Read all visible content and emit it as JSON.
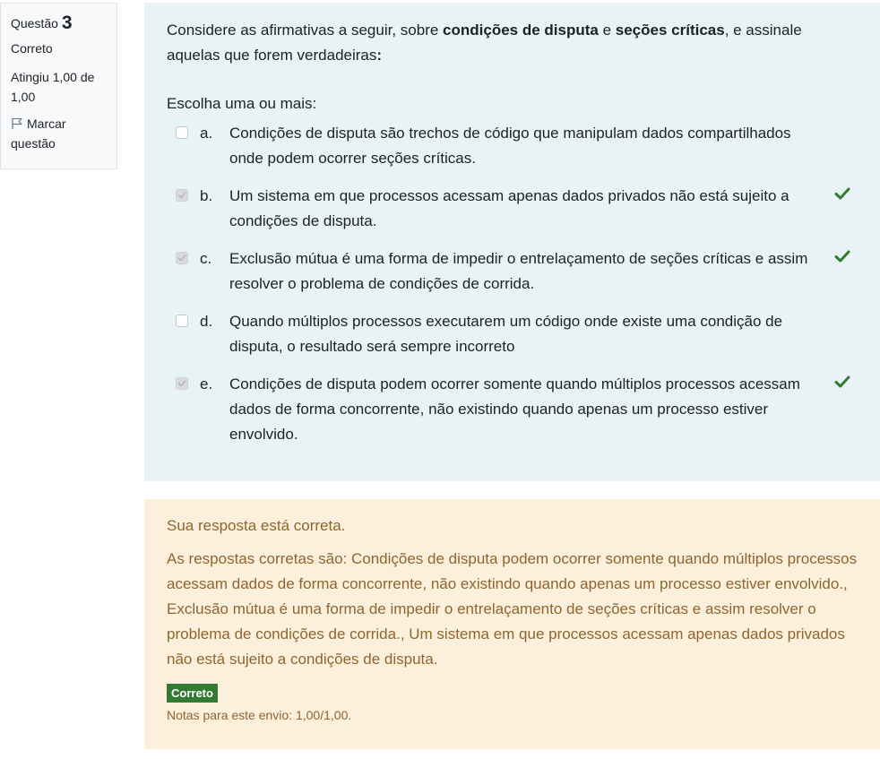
{
  "info": {
    "question_label": "Questão",
    "question_number": "3",
    "state": "Correto",
    "grade": "Atingiu 1,00 de 1,00",
    "flag_label": "Marcar questão"
  },
  "question": {
    "text_part1": "Considere as afirmativas a seguir, sobre ",
    "bold1": "condições de disputa",
    "text_part2": " e ",
    "bold2": "seções críticas",
    "text_part3": ", e assinale aquelas que forem verdadeiras",
    "bold3": ":",
    "prompt": "Escolha uma ou mais:",
    "answers": [
      {
        "letter": "a.",
        "text": "Condições de disputa são trechos de código que manipulam dados compartilhados onde podem ocorrer seções críticas.",
        "checked": false,
        "correct_mark": false
      },
      {
        "letter": "b.",
        "text": "Um sistema em que processos acessam apenas dados privados não está sujeito a condições de disputa.",
        "checked": true,
        "correct_mark": true
      },
      {
        "letter": "c.",
        "text": "Exclusão mútua é uma forma de impedir o entrelaçamento de seções críticas e assim resolver o problema de condições de corrida.",
        "checked": true,
        "correct_mark": true
      },
      {
        "letter": "d.",
        "text": "Quando múltiplos processos executarem um código onde existe uma condição de disputa, o resultado será sempre incorreto",
        "checked": false,
        "correct_mark": false
      },
      {
        "letter": "e.",
        "text": "Condições de disputa podem ocorrer somente quando múltiplos processos acessam dados de forma concorrente, não existindo quando apenas um processo estiver envolvido.",
        "checked": true,
        "correct_mark": true
      }
    ]
  },
  "outcome": {
    "feedback": "Sua resposta está correta.",
    "right_answer": "As respostas corretas são: Condições de disputa podem ocorrer somente quando múltiplos processos acessam dados de forma concorrente, não existindo quando apenas um processo estiver envolvido., Exclusão mútua é uma forma de impedir o entrelaçamento de seções críticas e assim resolver o problema de condições de corrida., Um sistema em que processos acessam apenas dados privados não está sujeito a condições de disputa.",
    "badge": "Correto",
    "marks": "Notas para este envio: 1,00/1,00."
  },
  "colors": {
    "formulation_bg": "#e7f3f5",
    "outcome_bg": "#fcefdc",
    "outcome_text": "#8e662e",
    "correct_green": "#357a32"
  },
  "icons": {
    "flag": "flag-icon",
    "correct": "check-icon"
  }
}
